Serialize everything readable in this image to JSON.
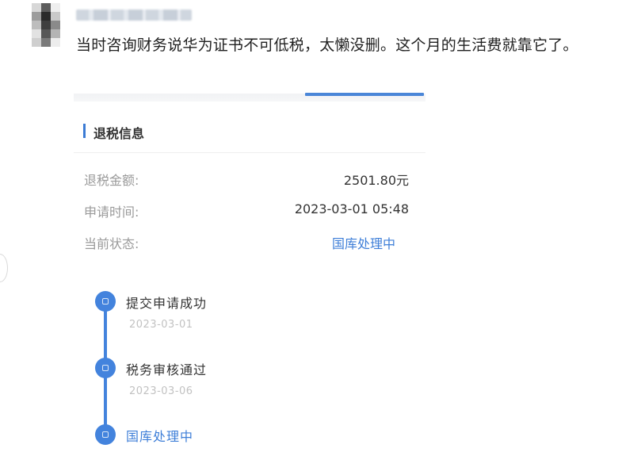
{
  "post": {
    "text": "当时咨询财务说华为证书不可低税，太懒没删。这个月的生活费就靠它了。"
  },
  "screenshot": {
    "section_title": "退税信息",
    "rows": [
      {
        "label": "退税金额:",
        "value": "2501.80元"
      },
      {
        "label": "申请时间:",
        "value": "2023-03-01 05:48"
      },
      {
        "label": "当前状态:",
        "value": "国库处理中"
      }
    ],
    "timeline": [
      {
        "title": "提交申请成功",
        "date": "2023-03-01"
      },
      {
        "title": "税务审核通过",
        "date": "2023-03-06"
      },
      {
        "title": "国库处理中",
        "date": ""
      }
    ],
    "colors": {
      "accent": "#4383dd",
      "status_text": "#3f7fd8"
    }
  }
}
